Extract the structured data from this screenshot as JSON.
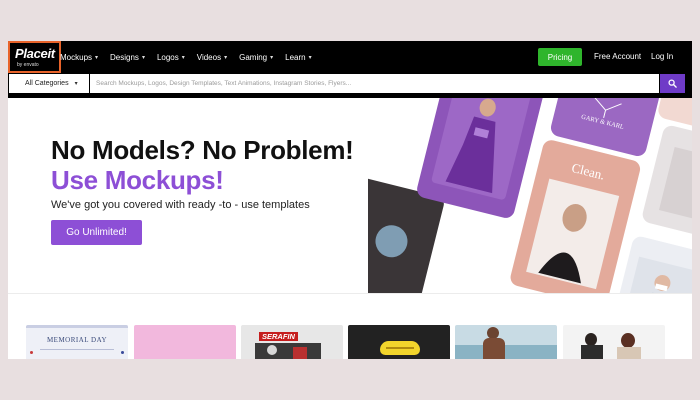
{
  "logo": {
    "text": "Placeit",
    "sub": "by envato"
  },
  "nav": {
    "items": [
      {
        "label": "Mockups"
      },
      {
        "label": "Designs"
      },
      {
        "label": "Logos"
      },
      {
        "label": "Videos"
      },
      {
        "label": "Gaming"
      },
      {
        "label": "Learn"
      }
    ],
    "pricing": "Pricing",
    "free_account": "Free Account",
    "login": "Log In"
  },
  "search": {
    "category": "All Categories",
    "placeholder": "Search Mockups, Logos, Design Templates, Text Animations, Instagram Stories, Flyers..."
  },
  "hero": {
    "headline_line1": "No Models? No Problem!",
    "headline_line2": "Use Mockups!",
    "subtext": "We've got you covered with ready -to - use templates",
    "cta": "Go Unlimited!",
    "collage_texts": {
      "gary": "GARY & KARL",
      "clean": "Clean."
    }
  },
  "thumbnails": {
    "memorial": "MEMORIAL DAY",
    "serafin": "SERAFIN"
  },
  "colors": {
    "accent_purple": "#8d4fd6",
    "pricing_green": "#2fb52c",
    "logo_border": "#e8632a",
    "search_button": "#6f3bc7"
  },
  "icons": {
    "search_button": "search-icon",
    "dropdown": "chevron-down-icon"
  }
}
